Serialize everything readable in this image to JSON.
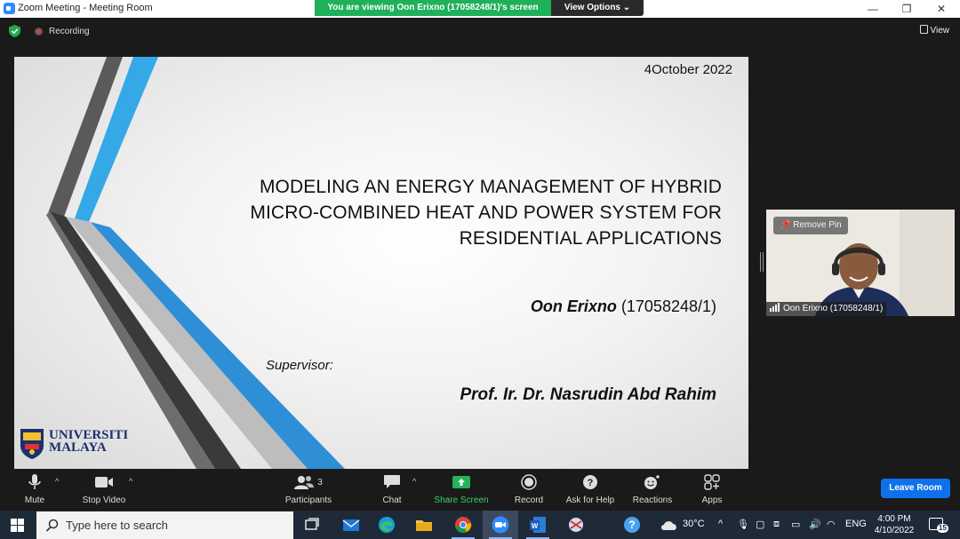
{
  "window": {
    "title": "Zoom Meeting - Meeting Room",
    "controls": {
      "minimize": "—",
      "restore": "❐",
      "close": "✕"
    }
  },
  "share_banner": {
    "text": "You are viewing Oon Erixno (17058248/1)'s screen",
    "view_options_label": "View Options"
  },
  "top_strip": {
    "recording_label": "Recording",
    "view_label": "View"
  },
  "slide": {
    "date": "4October 2022",
    "title_lines": [
      "MODELING AN ENERGY MANAGEMENT OF HYBRID",
      "MICRO-COMBINED HEAT AND POWER SYSTEM FOR",
      "RESIDENTIAL APPLICATIONS"
    ],
    "presenter_name": "Oon Erixno",
    "presenter_id": "(17058248/1)",
    "supervisor_label": "Supervisor:",
    "supervisor_name": "Prof. Ir. Dr. Nasrudin Abd Rahim",
    "logo_line1": "UNIVERSITI",
    "logo_line2": "MALAYA",
    "colors": {
      "stripe_blue": "#2f8fd6",
      "stripe_dark": "#3d3d3d",
      "stripe_light_blue": "#35a8e8"
    }
  },
  "participant_video": {
    "remove_pin_label": "Remove Pin",
    "name": "Oon Erixno (17058248/1)"
  },
  "toolbar": {
    "mute": "Mute",
    "stop_video": "Stop Video",
    "participants": "Participants",
    "participants_count": "3",
    "chat": "Chat",
    "share_screen": "Share Screen",
    "record": "Record",
    "ask_for_help": "Ask for Help",
    "reactions": "Reactions",
    "apps": "Apps",
    "leave": "Leave Room",
    "share_color": "#3ecf6d",
    "leave_color": "#0e71eb"
  },
  "taskbar": {
    "search_placeholder": "Type here to search",
    "weather": "30°C",
    "language": "ENG",
    "time": "4:00 PM",
    "date": "4/10/2022",
    "notification_count": "15"
  }
}
